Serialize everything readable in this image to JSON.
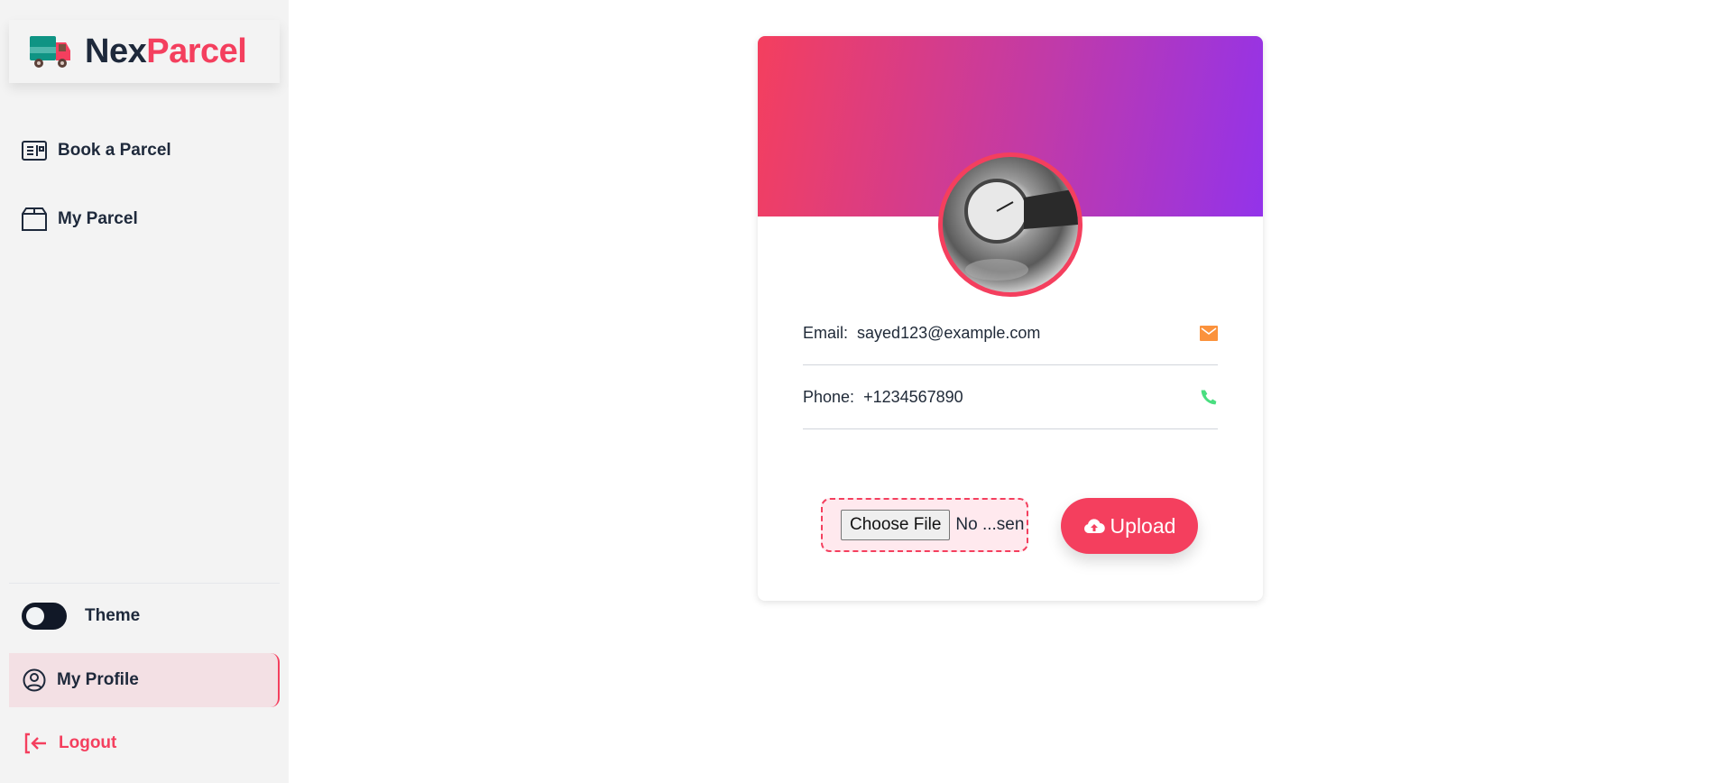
{
  "brand": {
    "name_part1": "Nex",
    "name_part2": "Parcel",
    "icon": "truck-icon"
  },
  "sidebar": {
    "items": [
      {
        "label": "Book a Parcel",
        "icon": "booking-icon"
      },
      {
        "label": "My Parcel",
        "icon": "box-icon"
      }
    ],
    "theme_label": "Theme",
    "theme_toggle_on": false,
    "profile_label": "My Profile",
    "logout_label": "Logout"
  },
  "profile": {
    "email_label": "Email:",
    "email": "sayed123@example.com",
    "phone_label": "Phone:",
    "phone": "+1234567890",
    "choose_file_label": "Choose File",
    "file_status": "No ...sen",
    "upload_label": "Upload"
  },
  "colors": {
    "accent": "#f43f5e",
    "gradient_start": "#f43f5e",
    "gradient_end": "#9333ea",
    "email_icon": "#fb923c",
    "phone_icon": "#4ade80",
    "active_bg": "#f3e0e4"
  }
}
